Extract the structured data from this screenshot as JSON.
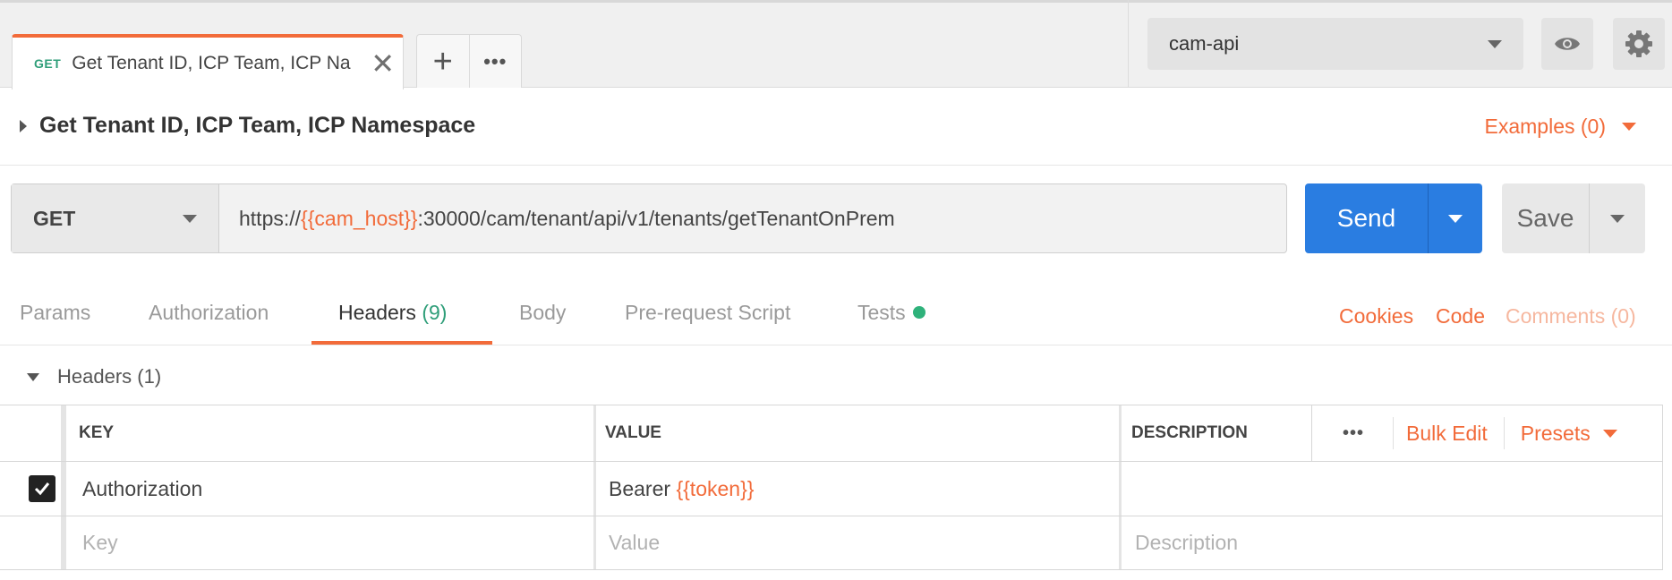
{
  "tab": {
    "method": "GET",
    "title": "Get Tenant ID, ICP Team, ICP Na",
    "close": "✕"
  },
  "tab_actions": {
    "new_tab": "+",
    "more": "•••"
  },
  "environment": {
    "selected": "cam-api"
  },
  "request": {
    "name": "Get Tenant ID, ICP Team, ICP Namespace",
    "examples_label": "Examples (0)",
    "method": "GET",
    "url_prefix": "https://",
    "url_variable": "{{cam_host}}",
    "url_suffix": ":30000/cam/tenant/api/v1/tenants/getTenantOnPrem",
    "send_label": "Send",
    "save_label": "Save"
  },
  "request_tabs": {
    "params": "Params",
    "authorization": "Authorization",
    "headers_label": "Headers",
    "headers_count": "(9)",
    "body": "Body",
    "prerequest": "Pre-request Script",
    "tests": "Tests"
  },
  "right_links": {
    "cookies": "Cookies",
    "code": "Code",
    "comments": "Comments (0)"
  },
  "headers_section": {
    "title": "Headers",
    "count": "(1)",
    "columns": {
      "key": "KEY",
      "value": "VALUE",
      "description": "DESCRIPTION"
    },
    "more": "•••",
    "bulk_edit": "Bulk Edit",
    "presets": "Presets",
    "rows": [
      {
        "checked": true,
        "key": "Authorization",
        "value_prefix": "Bearer ",
        "value_variable": "{{token}}",
        "description": ""
      }
    ],
    "placeholders": {
      "key": "Key",
      "value": "Value",
      "description": "Description"
    }
  },
  "colors": {
    "accent": "#f26b3a",
    "send": "#2a7de1",
    "get_method": "#2f9e79",
    "tests_dot": "#2fb27b"
  }
}
